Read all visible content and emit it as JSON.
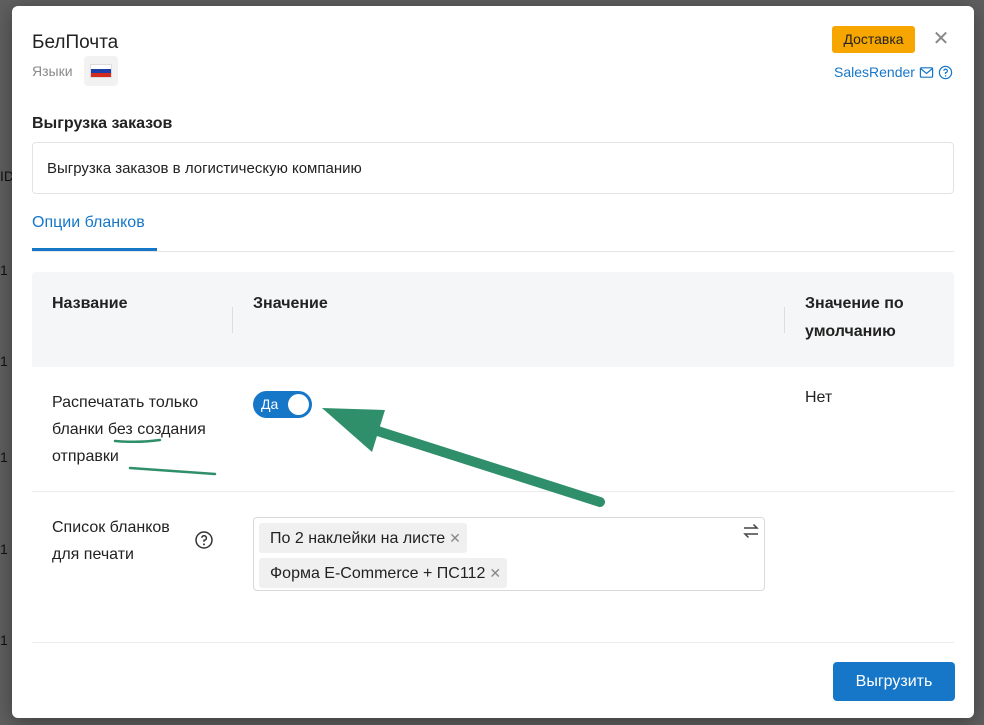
{
  "backdrop": {
    "fragments": [
      "ID",
      "1",
      "1",
      "1",
      "1",
      "1"
    ]
  },
  "modal": {
    "title": "БелПочта",
    "languages_label": "Языки",
    "language_flag": "russian-flag",
    "category_badge": "Доставка",
    "brand_link": "SalesRender",
    "brand_icons": [
      "mail-icon",
      "help-icon"
    ],
    "close_icon": "close-icon"
  },
  "section": {
    "title": "Выгрузка заказов",
    "description": "Выгрузка заказов в логистическую компанию"
  },
  "tabs": [
    {
      "label": "Опции бланков",
      "active": true
    }
  ],
  "table": {
    "headers": [
      "Название",
      "Значение",
      "Значение по умолчанию"
    ],
    "rows": [
      {
        "name": "Распечатать только бланки без создания отправки",
        "value_type": "toggle",
        "toggle_label": "Да",
        "toggle_on": true,
        "default": "Нет"
      },
      {
        "name": "Список бланков для печати",
        "value_type": "multiselect",
        "tags": [
          "По 2 наклейки на листе",
          "Форма E-Commerce + ПС112"
        ],
        "default": ""
      }
    ]
  },
  "submit_label": "Выгрузить",
  "colors": {
    "accent": "#1677c9",
    "badge": "#f7a600",
    "annotation": "#2f8f6a"
  }
}
